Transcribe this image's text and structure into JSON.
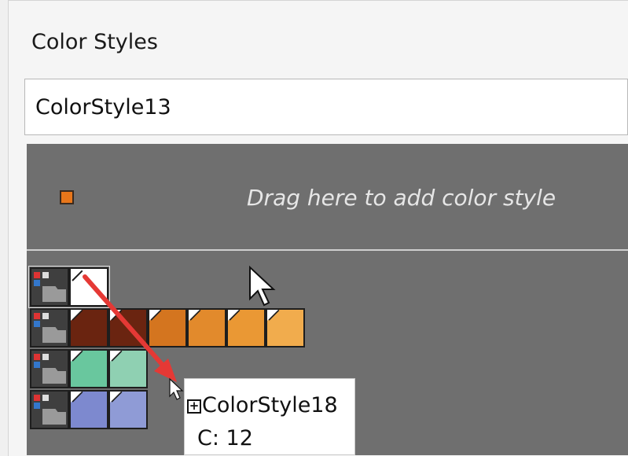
{
  "panel": {
    "title": "Color Styles"
  },
  "style_name_field": {
    "value": "ColorStyle13"
  },
  "drop_zone": {
    "text": "Drag here to add color style",
    "icon_color": "#e8761a"
  },
  "swatch_rows": [
    {
      "name": "row-1",
      "colors": []
    },
    {
      "name": "row-browns-oranges",
      "colors": [
        "#6a2410",
        "#6a2410",
        "#d4751f",
        "#e28a2c",
        "#ea9834",
        "#f1ac4d"
      ]
    },
    {
      "name": "row-greens",
      "colors": [
        "#69c79e",
        "#8fd0b2"
      ]
    },
    {
      "name": "row-blues",
      "colors": [
        "#7d89cf",
        "#8f9bd6"
      ]
    }
  ],
  "drag_tooltip": {
    "name": "ColorStyle18",
    "count": "C: 12"
  },
  "colors": {
    "accent_arrow": "#e53935",
    "swatch_background": "#6f6f6f"
  }
}
